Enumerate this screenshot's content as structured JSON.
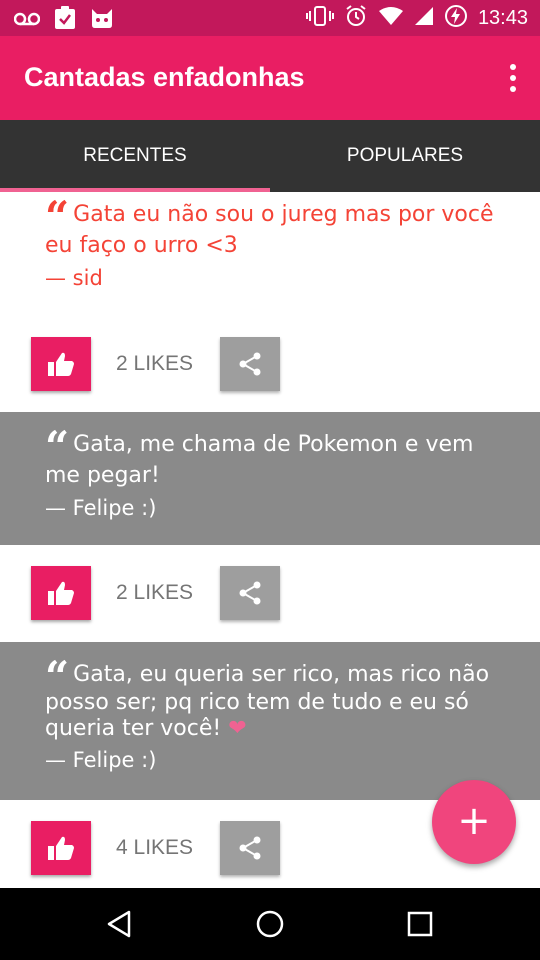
{
  "status_bar": {
    "time": "13:43",
    "left_icons": [
      "voicemail-icon",
      "clipboard-check-icon",
      "cat-app-icon"
    ],
    "right_icons": [
      "vibrate-icon",
      "alarm-icon",
      "wifi-icon",
      "signal-icon",
      "battery-charging-icon"
    ]
  },
  "app_bar": {
    "title": "Cantadas enfadonhas",
    "menu_icon": "overflow-menu-icon"
  },
  "tabs": [
    {
      "label": "RECENTES",
      "active": true
    },
    {
      "label": "POPULARES",
      "active": false
    }
  ],
  "posts": [
    {
      "quote_mark": "“",
      "text": "Gata eu não sou o jureg mas por você eu faço o urro <3",
      "author": "— sid",
      "likes_label": "2 LIKES"
    },
    {
      "quote_mark": "“",
      "text": "Gata, me chama de Pokemon e vem me pegar!",
      "author": "— Felipe :)",
      "likes_label": "2 LIKES"
    },
    {
      "quote_mark": "“",
      "text": "Gata, eu queria ser rico, mas rico não posso ser; pq rico tem de tudo e eu só queria ter você!",
      "emoji": "heart-icon",
      "author": "— Felipe :)",
      "likes_label": "4 LIKES"
    }
  ],
  "fab": {
    "label": "+"
  },
  "colors": {
    "status_bar": "#c2185b",
    "primary": "#e91e63",
    "tab_bar": "#333333",
    "tab_indicator": "#f06292",
    "quote_red": "#f44336",
    "card_gray": "#8a8a8a",
    "share_gray": "#9e9e9e",
    "fab": "#f0457d"
  }
}
